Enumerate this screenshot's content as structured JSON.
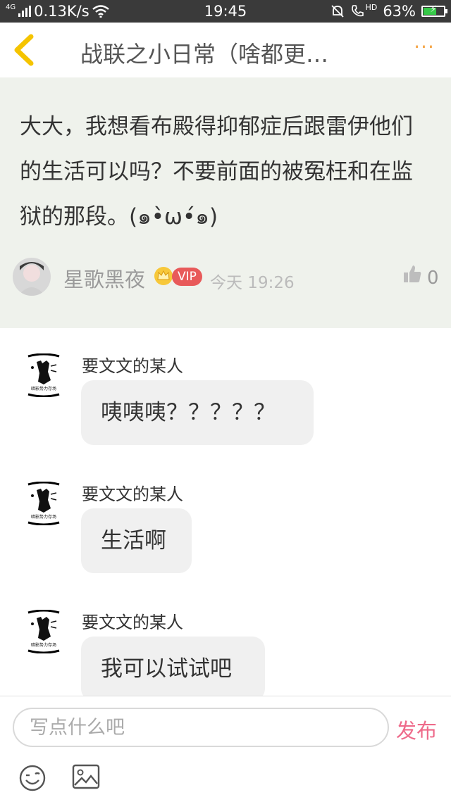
{
  "status_bar": {
    "network_label": "4G",
    "speed": "0.13K/s",
    "time": "19:45",
    "hd_label": "HD",
    "battery": "63%",
    "battery_level": 0.63,
    "battery_color": "#36c948"
  },
  "nav": {
    "title": "战联之小日常（啥都更…",
    "back_icon": "chevron-left-icon",
    "more_icon": "more-dots-icon",
    "more_label": "···",
    "accent": "#f5c400"
  },
  "post": {
    "text": "大大，我想看布殿得抑郁症后跟雷伊他们的生活可以吗？不要前面的被冤枉和在监狱的那段。(๑•̀ω•́๑)",
    "author": "星歌黑夜",
    "vip_label": "VIP",
    "time": "今天 19:26",
    "likes": "0",
    "background": "#eff2ec"
  },
  "comments": [
    {
      "name": "要文文的某人",
      "text": "咦咦咦？？？？？",
      "avatar_caption": "暗影势力存场"
    },
    {
      "name": "要文文的某人",
      "text": "生活啊",
      "avatar_caption": "暗影势力存场"
    },
    {
      "name": "要文文的某人",
      "text": "我可以试试吧",
      "avatar_caption": "暗影势力存场"
    }
  ],
  "composer": {
    "placeholder": "写点什么吧",
    "send_label": "发布",
    "send_color": "#ee6a8a"
  }
}
